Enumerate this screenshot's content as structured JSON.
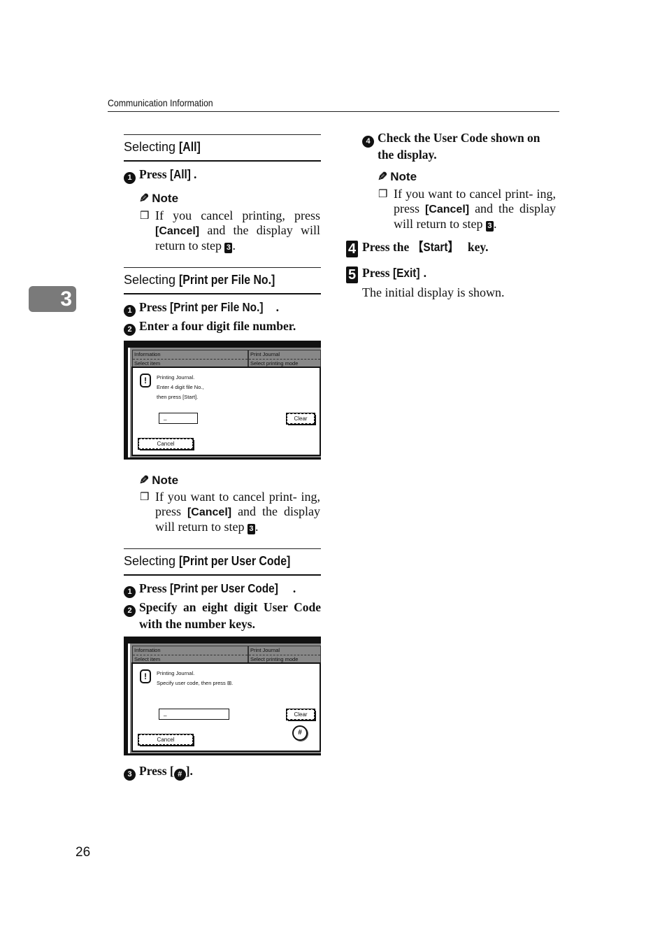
{
  "running_head": "Communication Information",
  "chapter_tab": "3",
  "page_number": "26",
  "sections": [
    {
      "title_prefix": "Selecting ",
      "title_key": "[All]",
      "steps": [
        {
          "num": "1",
          "text": "Press ",
          "key": "[All]",
          "suffix": "."
        }
      ],
      "note": {
        "heading": "Note",
        "line1": "If you cancel printing, press",
        "key": "[Cancel]",
        "line2": " and the display will",
        "line3": "return to step ",
        "step_ref": "3"
      }
    },
    {
      "title_prefix": "Selecting ",
      "title_key": "[Print per File No.]",
      "steps": [
        {
          "num": "1",
          "text": "Press ",
          "key": "[Print per File No.]",
          "suffix": "."
        },
        {
          "num": "2",
          "text": "Enter a four digit file number."
        }
      ],
      "screen": {
        "header_left_1": "Information",
        "header_left_2": "Select item",
        "header_right_1": "Print Journal",
        "header_right_2": "Select printing mode",
        "message_lines": [
          "Printing Journal.",
          "Enter 4 digit file No.,",
          "then press [Start]."
        ],
        "input_value": "_",
        "clear_button": "Clear",
        "cancel_button": "Cancel"
      },
      "note": {
        "heading": "Note",
        "line1": "If you want to cancel print-",
        "line2a": "ing, press ",
        "key": "[Cancel]",
        "line2b": " and the",
        "line3": "display will return to step ",
        "step_ref": "3"
      }
    },
    {
      "title_prefix": "Selecting ",
      "title_key": "[Print per User Code]",
      "steps": [
        {
          "num": "1",
          "text": "Press ",
          "key": "[Print per User Code]",
          "suffix": "."
        },
        {
          "num": "2",
          "text": "Specify an eight digit User Code with the number keys."
        },
        {
          "num": "3",
          "text": "Press [",
          "icon": "#",
          "suffix": "]."
        }
      ],
      "screen": {
        "header_left_1": "Information",
        "header_left_2": "Select item",
        "header_right_1": "Print Journal",
        "header_right_2": "Select printing mode",
        "message_lines": [
          "Printing Journal.",
          "Specify user code, then press ⊞."
        ],
        "input_value": "_",
        "clear_button": "Clear",
        "cancel_button": "Cancel",
        "hash_button": "#"
      }
    }
  ],
  "right_column": {
    "step4": {
      "num": "4",
      "text": "Check the User Code shown on the display."
    },
    "note": {
      "heading": "Note",
      "line1": "If you want to cancel print-",
      "line2a": "ing, press ",
      "key": "[Cancel]",
      "line2b": " and the",
      "line3": "display will return to step ",
      "step_ref": "3"
    },
    "main_step4": {
      "num": "4",
      "text": "Press the ",
      "key": "Start",
      "suffix": " key."
    },
    "main_step5": {
      "num": "5",
      "text": "Press ",
      "key": "[Exit]",
      "suffix": "."
    },
    "result": "The initial display is shown."
  }
}
